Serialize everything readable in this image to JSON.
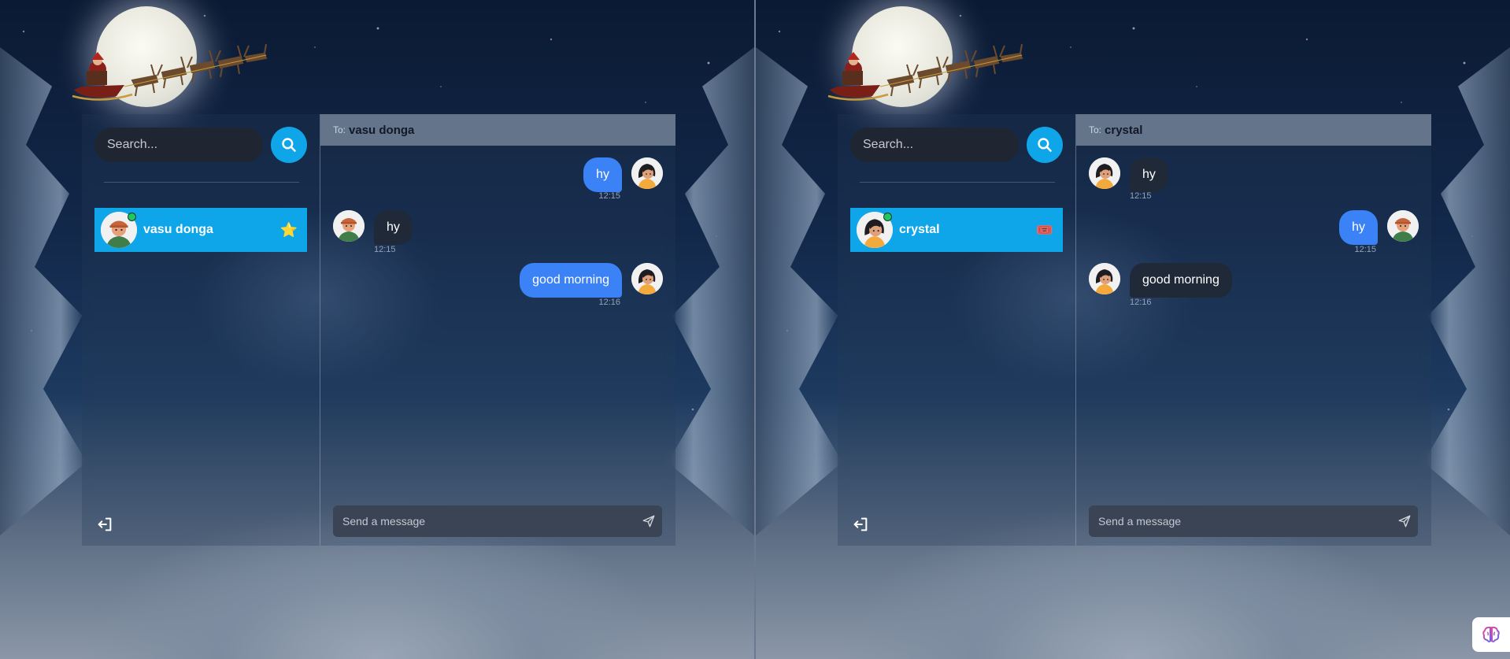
{
  "colors": {
    "accent": "#0ea5e9",
    "sent_bubble": "#3b82f6",
    "received_bubble": "#1f2937",
    "header_bar": "#64748b",
    "online": "#22c55e"
  },
  "panes": [
    {
      "search": {
        "placeholder": "Search..."
      },
      "contact": {
        "name": "vasu donga",
        "status": "online",
        "emoji": "⭐"
      },
      "chat": {
        "to_label": "To:",
        "to_name": "vasu donga",
        "messages": [
          {
            "text": "hy",
            "time": "12:15",
            "direction": "sent"
          },
          {
            "text": "hy",
            "time": "12:15",
            "direction": "received"
          },
          {
            "text": "good morning",
            "time": "12:16",
            "direction": "sent"
          }
        ],
        "composer_placeholder": "Send a message"
      }
    },
    {
      "search": {
        "placeholder": "Search..."
      },
      "contact": {
        "name": "crystal",
        "status": "online",
        "emoji": "🎟️"
      },
      "chat": {
        "to_label": "To:",
        "to_name": "crystal",
        "messages": [
          {
            "text": "hy",
            "time": "12:15",
            "direction": "received"
          },
          {
            "text": "hy",
            "time": "12:15",
            "direction": "sent"
          },
          {
            "text": "good morning",
            "time": "12:16",
            "direction": "received"
          }
        ],
        "composer_placeholder": "Send a message"
      }
    }
  ],
  "icons": {
    "search": "search-icon",
    "logout": "logout-icon",
    "send": "send-icon",
    "extension": "brain-icon"
  }
}
